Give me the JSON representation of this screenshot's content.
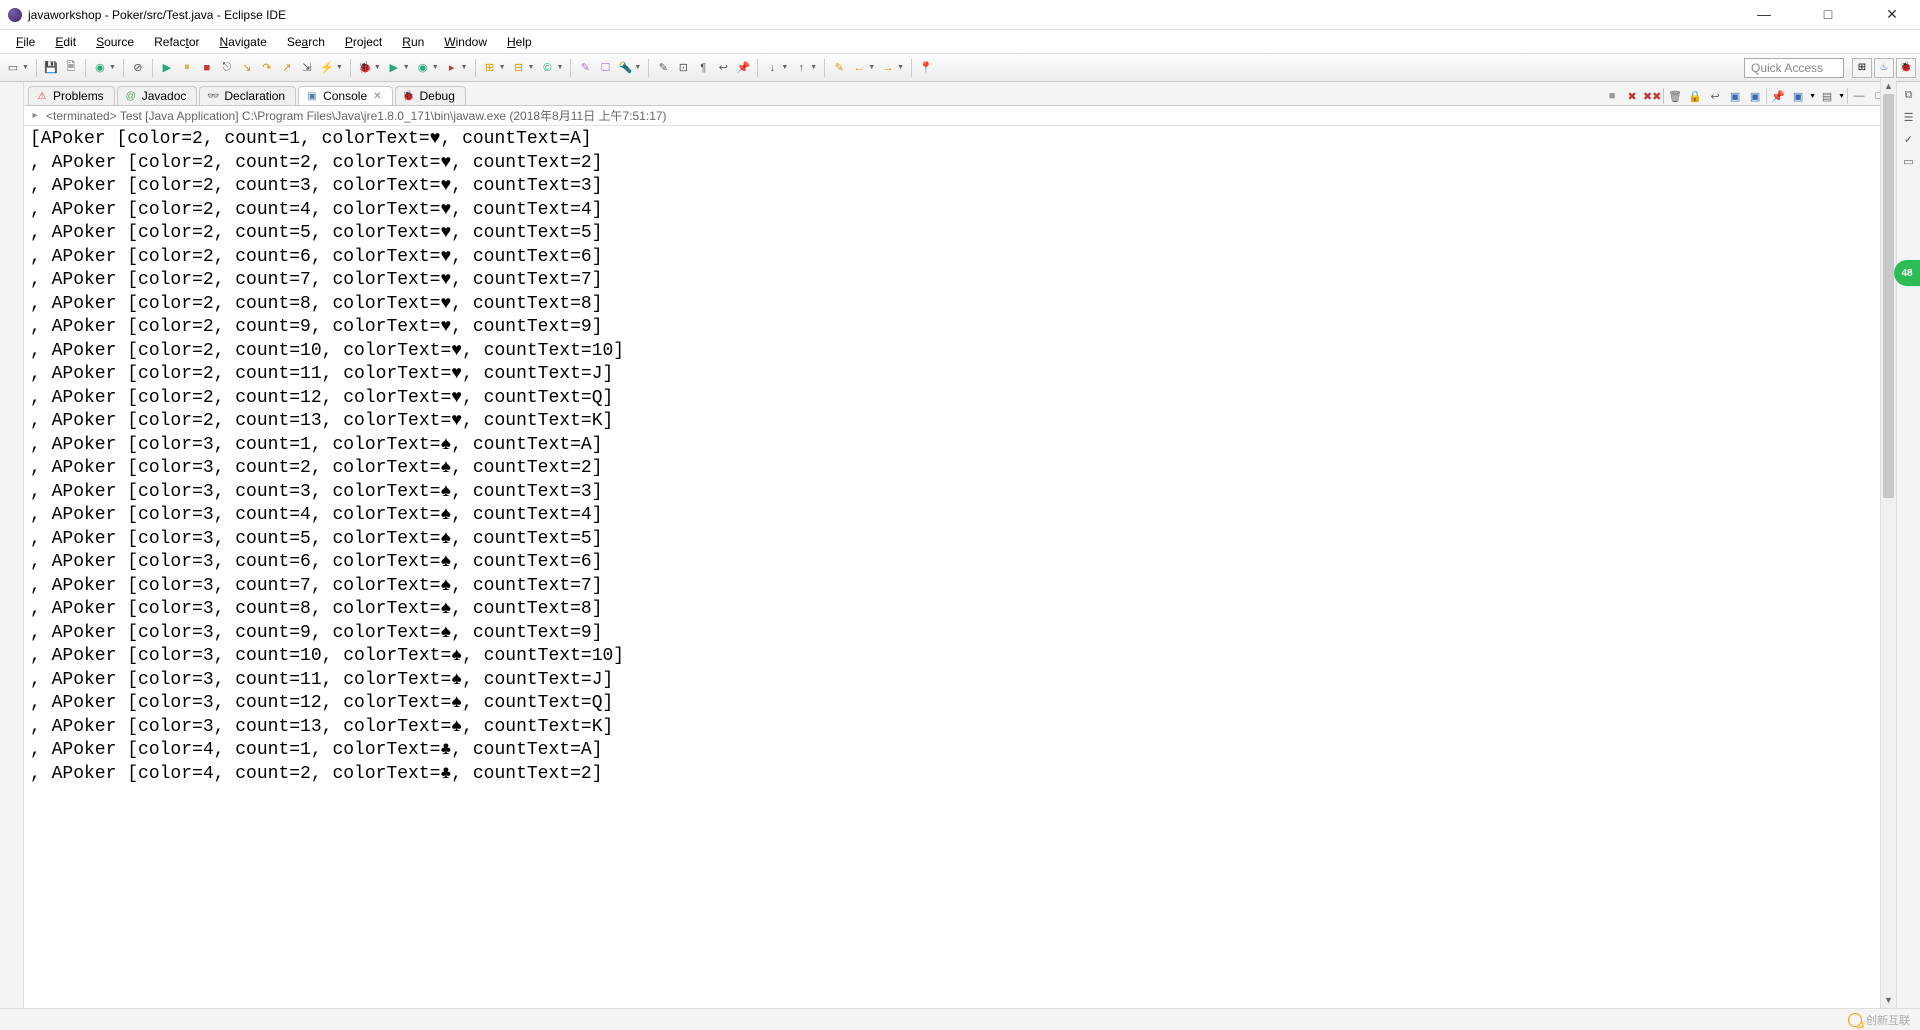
{
  "titlebar": {
    "title": "javaworkshop - Poker/src/Test.java - Eclipse IDE"
  },
  "menu": {
    "items": [
      {
        "mn": "F",
        "rest": "ile"
      },
      {
        "mn": "E",
        "rest": "dit"
      },
      {
        "mn": "S",
        "rest": "ource"
      },
      {
        "mn": "",
        "rest": "Refac",
        "mn2": "t",
        "rest2": "or"
      },
      {
        "mn": "N",
        "rest": "avigate"
      },
      {
        "mn": "",
        "rest": "Se",
        "mn2": "a",
        "rest2": "rch"
      },
      {
        "mn": "P",
        "rest": "roject"
      },
      {
        "mn": "R",
        "rest": "un"
      },
      {
        "mn": "W",
        "rest": "indow"
      },
      {
        "mn": "H",
        "rest": "elp"
      }
    ]
  },
  "toolbar": {
    "quick_access": "Quick Access"
  },
  "views": {
    "tabs": [
      {
        "icon": "⚠",
        "iconColor": "#c44",
        "label": "Problems"
      },
      {
        "icon": "@",
        "iconColor": "#5a9e6f",
        "label": "Javadoc"
      },
      {
        "icon": "👓",
        "iconColor": "#666",
        "label": "Declaration"
      },
      {
        "icon": "▣",
        "iconColor": "#5a7fa8",
        "label": "Console",
        "active": true,
        "closable": true
      },
      {
        "icon": "🐞",
        "iconColor": "#5a9e6f",
        "label": "Debug"
      }
    ]
  },
  "console": {
    "process_label": "<terminated> Test [Java Application] C:\\Program Files\\Java\\jre1.8.0_171\\bin\\javaw.exe (2018年8月11日 上午7:51:17)",
    "lines": [
      "[APoker [color=2, count=1, colorText=♥, countText=A]",
      ", APoker [color=2, count=2, colorText=♥, countText=2]",
      ", APoker [color=2, count=3, colorText=♥, countText=3]",
      ", APoker [color=2, count=4, colorText=♥, countText=4]",
      ", APoker [color=2, count=5, colorText=♥, countText=5]",
      ", APoker [color=2, count=6, colorText=♥, countText=6]",
      ", APoker [color=2, count=7, colorText=♥, countText=7]",
      ", APoker [color=2, count=8, colorText=♥, countText=8]",
      ", APoker [color=2, count=9, colorText=♥, countText=9]",
      ", APoker [color=2, count=10, colorText=♥, countText=10]",
      ", APoker [color=2, count=11, colorText=♥, countText=J]",
      ", APoker [color=2, count=12, colorText=♥, countText=Q]",
      ", APoker [color=2, count=13, colorText=♥, countText=K]",
      ", APoker [color=3, count=1, colorText=♠, countText=A]",
      ", APoker [color=3, count=2, colorText=♠, countText=2]",
      ", APoker [color=3, count=3, colorText=♠, countText=3]",
      ", APoker [color=3, count=4, colorText=♠, countText=4]",
      ", APoker [color=3, count=5, colorText=♠, countText=5]",
      ", APoker [color=3, count=6, colorText=♠, countText=6]",
      ", APoker [color=3, count=7, colorText=♠, countText=7]",
      ", APoker [color=3, count=8, colorText=♠, countText=8]",
      ", APoker [color=3, count=9, colorText=♠, countText=9]",
      ", APoker [color=3, count=10, colorText=♠, countText=10]",
      ", APoker [color=3, count=11, colorText=♠, countText=J]",
      ", APoker [color=3, count=12, colorText=♠, countText=Q]",
      ", APoker [color=3, count=13, colorText=♠, countText=K]",
      ", APoker [color=4, count=1, colorText=♣, countText=A]",
      ", APoker [color=4, count=2, colorText=♣, countText=2]"
    ]
  },
  "watermark": {
    "text": "创新互联"
  },
  "float_badge": "48"
}
